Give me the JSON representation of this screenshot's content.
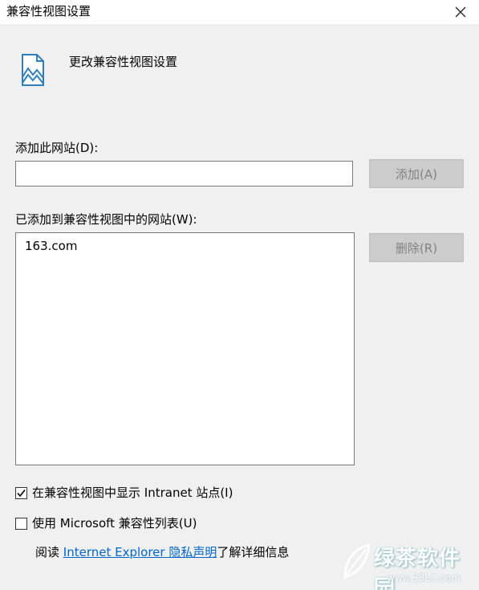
{
  "window": {
    "title": "兼容性视图设置"
  },
  "header": {
    "heading": "更改兼容性视图设置",
    "icon": "document-image-icon"
  },
  "add_site": {
    "label": "添加此网站(D):",
    "input_value": "",
    "add_button": "添加(A)"
  },
  "added_sites": {
    "label": "已添加到兼容性视图中的网站(W):",
    "items": [
      "163.com"
    ],
    "remove_button": "删除(R)"
  },
  "options": {
    "intranet": {
      "label": "在兼容性视图中显示 Intranet 站点(I)",
      "checked": true
    },
    "ms_list": {
      "label": "使用 Microsoft 兼容性列表(U)",
      "checked": false
    }
  },
  "privacy": {
    "prefix": "阅读 ",
    "link": "Internet Explorer 隐私声明",
    "suffix": "了解详细信息"
  },
  "watermark": {
    "title": "绿茶软件园",
    "url": "www.33LC.com"
  },
  "colors": {
    "background": "#f0f0f0",
    "link": "#0066cc",
    "disabled_button": "#cccccc",
    "disabled_text": "#838383"
  }
}
